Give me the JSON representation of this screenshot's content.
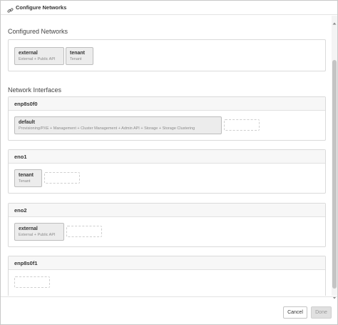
{
  "dialog": {
    "title": "Configure Networks",
    "icon": "link-icon"
  },
  "configured": {
    "title": "Configured Networks",
    "chips": [
      {
        "name": "external",
        "desc": "External + Public API"
      },
      {
        "name": "tenant",
        "desc": "Tenant"
      }
    ]
  },
  "interfaces": {
    "title": "Network Interfaces",
    "items": [
      {
        "name": "enp8s0f0",
        "chips": [
          {
            "name": "default",
            "desc": "Provisioning/PXE + Management + Cluster Management + Admin API + Storage + Storage Clustering"
          }
        ]
      },
      {
        "name": "eno1",
        "chips": [
          {
            "name": "tenant",
            "desc": "Tenant"
          }
        ]
      },
      {
        "name": "eno2",
        "chips": [
          {
            "name": "external",
            "desc": "External + Public API"
          }
        ]
      },
      {
        "name": "enp8s0f1",
        "chips": []
      }
    ]
  },
  "footer": {
    "cancel_label": "Cancel",
    "done_label": "Done"
  }
}
